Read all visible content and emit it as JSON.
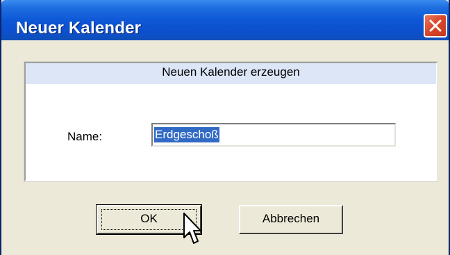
{
  "window": {
    "title": "Neuer Kalender",
    "close_icon": "close-icon"
  },
  "panel": {
    "header": "Neuen Kalender erzeugen",
    "name_label": "Name:",
    "name_value": "Erdgeschoß"
  },
  "buttons": {
    "ok_label": "OK",
    "cancel_label": "Abbrechen"
  },
  "cursor": {
    "icon": "mouse-pointer-icon"
  },
  "colors": {
    "titlebar": "#0b4fcc",
    "close": "#d9492c",
    "panel_header": "#dce6f7",
    "selection": "#316ac5",
    "face": "#ece9d8"
  }
}
